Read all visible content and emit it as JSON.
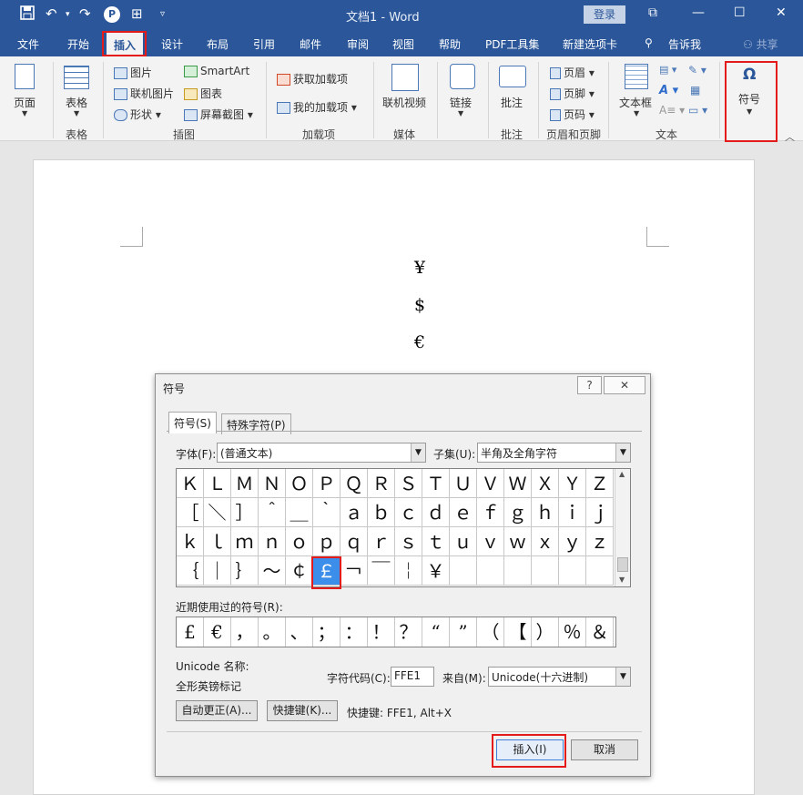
{
  "titlebar": {
    "title": "文档1 - Word",
    "login": "登录",
    "save_icon": "save-icon",
    "undo_icon": "undo-icon",
    "redo_icon": "redo-icon"
  },
  "menu": {
    "tabs": [
      "文件",
      "开始",
      "插入",
      "设计",
      "布局",
      "引用",
      "邮件",
      "审阅",
      "视图",
      "帮助",
      "PDF工具集",
      "新建选项卡"
    ],
    "tell": "告诉我",
    "share": "共享"
  },
  "ribbon": {
    "page": "页面",
    "table": "表格",
    "table_group": "表格",
    "picture": "图片",
    "online_picture": "联机图片",
    "shapes": "形状",
    "smartart": "SmartArt",
    "chart": "图表",
    "screenshot": "屏幕截图",
    "illus_group": "插图",
    "get_addins": "获取加载项",
    "my_addins": "我的加载项",
    "addins_group": "加载项",
    "online_video": "联机视频",
    "media_group": "媒体",
    "link": "链接",
    "comment": "批注",
    "comment_group": "批注",
    "header": "页眉",
    "footer": "页脚",
    "page_number": "页码",
    "hf_group": "页眉和页脚",
    "textbox": "文本框",
    "text_group": "文本",
    "symbol": "符号",
    "omega": "Ω"
  },
  "document": {
    "symbols": [
      "¥",
      "$",
      "€"
    ]
  },
  "dialog": {
    "title": "符号",
    "help": "?",
    "close": "✕",
    "tab_symbols": "符号(S)",
    "tab_special": "特殊字符(P)",
    "font_label": "字体(F):",
    "font_value": "(普通文本)",
    "subset_label": "子集(U):",
    "subset_value": "半角及全角字符",
    "grid": [
      [
        "Ｋ",
        "Ｌ",
        "Ｍ",
        "Ｎ",
        "Ｏ",
        "Ｐ",
        "Ｑ",
        "Ｒ",
        "Ｓ",
        "Ｔ",
        "Ｕ",
        "Ｖ",
        "Ｗ",
        "Ｘ",
        "Ｙ",
        "Ｚ"
      ],
      [
        "［",
        "＼",
        "］",
        "＾",
        "＿",
        "｀",
        "ａ",
        "ｂ",
        "ｃ",
        "ｄ",
        "ｅ",
        "ｆ",
        "ｇ",
        "ｈ",
        "ｉ",
        "ｊ"
      ],
      [
        "ｋ",
        "ｌ",
        "ｍ",
        "ｎ",
        "ｏ",
        "ｐ",
        "ｑ",
        "ｒ",
        "ｓ",
        "ｔ",
        "ｕ",
        "ｖ",
        "ｗ",
        "ｘ",
        "ｙ",
        "ｚ"
      ],
      [
        "｛",
        "｜",
        "｝",
        "～",
        "￠",
        "￡",
        "￢",
        "￣",
        "￤",
        "￥",
        "",
        "",
        "",
        "",
        "",
        ""
      ]
    ],
    "recent_label": "近期使用过的符号(R):",
    "recent": [
      "£",
      "€",
      "，",
      "。",
      "、",
      "；",
      "：",
      "！",
      "？",
      "“",
      "”",
      "（",
      "【",
      "）",
      "％",
      "＆"
    ],
    "unicode_name_label": "Unicode 名称:",
    "unicode_name_value": "全形英镑标记",
    "charcode_label": "字符代码(C):",
    "charcode_value": "FFE1",
    "from_label": "来自(M):",
    "from_value": "Unicode(十六进制)",
    "autocorrect": "自动更正(A)...",
    "shortcut_key": "快捷键(K)...",
    "shortcut_info": "快捷键: FFE1, Alt+X",
    "insert": "插入(I)",
    "cancel": "取消"
  }
}
